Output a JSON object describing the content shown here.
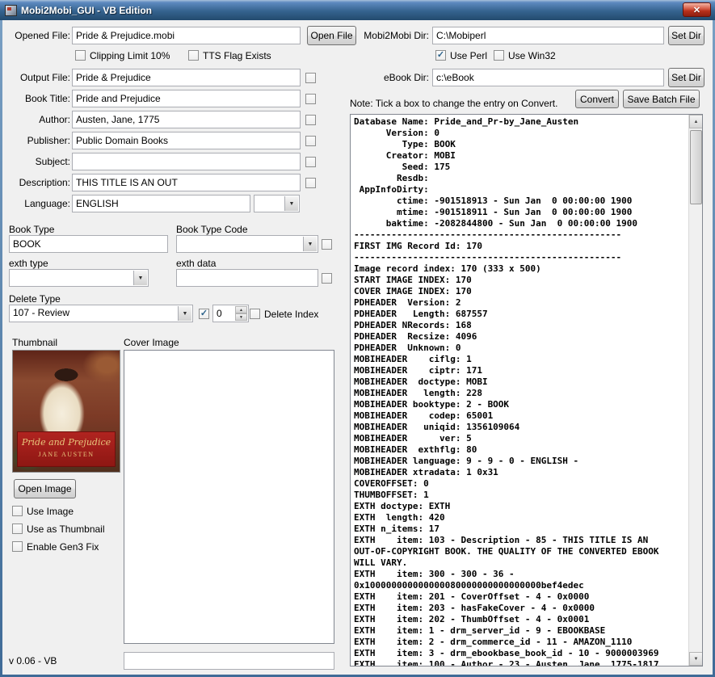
{
  "titlebar": {
    "title": "Mobi2Mobi_GUI - VB Edition"
  },
  "icons": {
    "close": "✕",
    "dropdown": "▼",
    "spin_up": "▲",
    "spin_down": "▼",
    "scroll_up": "▲",
    "scroll_down": "▼",
    "check": "✓"
  },
  "left": {
    "opened_file": {
      "label": "Opened File:",
      "value": "Pride & Prejudice.mobi"
    },
    "open_file_btn": "Open File",
    "clipping_limit": "Clipping Limit 10%",
    "tts_flag": "TTS Flag Exists",
    "output_file": {
      "label": "Output File:",
      "value": "Pride & Prejudice"
    },
    "book_title": {
      "label": "Book Title:",
      "value": "Pride and Prejudice"
    },
    "author": {
      "label": "Author:",
      "value": "Austen, Jane, 1775"
    },
    "publisher": {
      "label": "Publisher:",
      "value": "Public Domain Books"
    },
    "subject": {
      "label": "Subject:",
      "value": ""
    },
    "description": {
      "label": "Description:",
      "value": "THIS TITLE IS AN OUT"
    },
    "language": {
      "label": "Language:",
      "value": "ENGLISH",
      "combo_value": ""
    },
    "book_type": {
      "label": "Book Type",
      "value": "BOOK"
    },
    "book_type_code": {
      "label": "Book Type Code",
      "value": ""
    },
    "exth_type": {
      "label": "exth type",
      "value": ""
    },
    "exth_data": {
      "label": "exth data",
      "value": ""
    },
    "delete_type": {
      "label": "Delete Type",
      "value": "107 - Review"
    },
    "delete_count": "0",
    "delete_index": "Delete Index",
    "thumbnail_label": "Thumbnail",
    "cover_image_label": "Cover Image",
    "open_image_btn": "Open Image",
    "use_image": "Use Image",
    "use_as_thumbnail": "Use as Thumbnail",
    "enable_gen3": "Enable Gen3 Fix",
    "version": "v 0.06 - VB",
    "bottom_field_value": "",
    "thumb": {
      "title": "Pride and Prejudice",
      "author": "JANE AUSTEN"
    }
  },
  "right": {
    "mobi_dir": {
      "label": "Mobi2Mobi Dir:",
      "value": "C:\\Mobiperl"
    },
    "set_dir_btn": "Set Dir",
    "use_perl": "Use Perl",
    "use_win32": "Use Win32",
    "ebook_dir": {
      "label": "eBook Dir:",
      "value": "c:\\eBook"
    },
    "set_dir2_btn": "Set Dir",
    "note": "Note: Tick a box to change the entry on Convert.",
    "convert_btn": "Convert",
    "save_batch_btn": "Save Batch File",
    "console_lines": [
      "Database Name: Pride_and_Pr-by_Jane_Austen",
      "      Version: 0",
      "         Type: BOOK",
      "      Creator: MOBI",
      "         Seed: 175",
      "        Resdb:",
      " AppInfoDirty:",
      "        ctime: -901518913 - Sun Jan  0 00:00:00 1900",
      "        mtime: -901518911 - Sun Jan  0 00:00:00 1900",
      "      baktime: -2082844800 - Sun Jan  0 00:00:00 1900",
      "--------------------------------------------------",
      "FIRST IMG Record Id: 170",
      "--------------------------------------------------",
      "Image record index: 170 (333 x 500)",
      "START IMAGE INDEX: 170",
      "COVER IMAGE INDEX: 170",
      "PDHEADER  Version: 2",
      "PDHEADER   Length: 687557",
      "PDHEADER NRecords: 168",
      "PDHEADER  Recsize: 4096",
      "PDHEADER  Unknown: 0",
      "MOBIHEADER    ciflg: 1",
      "MOBIHEADER    ciptr: 171",
      "MOBIHEADER  doctype: MOBI",
      "MOBIHEADER   length: 228",
      "MOBIHEADER booktype: 2 - BOOK",
      "MOBIHEADER    codep: 65001",
      "MOBIHEADER   uniqid: 1356109064",
      "MOBIHEADER      ver: 5",
      "MOBIHEADER  exthflg: 80",
      "MOBIHEADER language: 9 - 9 - 0 - ENGLISH -",
      "MOBIHEADER xtradata: 1 0x31",
      "COVEROFFSET: 0",
      "THUMBOFFSET: 1",
      "EXTH doctype: EXTH",
      "EXTH  length: 420",
      "EXTH n_items: 17",
      "EXTH    item: 103 - Description - 85 - THIS TITLE IS AN",
      "OUT-OF-COPYRIGHT BOOK. THE QUALITY OF THE CONVERTED EBOOK",
      "WILL VARY.",
      "EXTH    item: 300 - 300 - 36 -",
      "0x100000000000000080000000000000000bef4edec",
      "EXTH    item: 201 - CoverOffset - 4 - 0x0000",
      "EXTH    item: 203 - hasFakeCover - 4 - 0x0000",
      "EXTH    item: 202 - ThumbOffset - 4 - 0x0001",
      "EXTH    item: 1 - drm_server_id - 9 - EBOOKBASE",
      "EXTH    item: 2 - drm_commerce_id - 11 - AMAZON_1110",
      "EXTH    item: 3 - drm_ebookbase_book_id - 10 - 9000003969",
      "EXTH    item: 100 - Author - 23 - Austen, Jane, 1775-1817"
    ]
  }
}
